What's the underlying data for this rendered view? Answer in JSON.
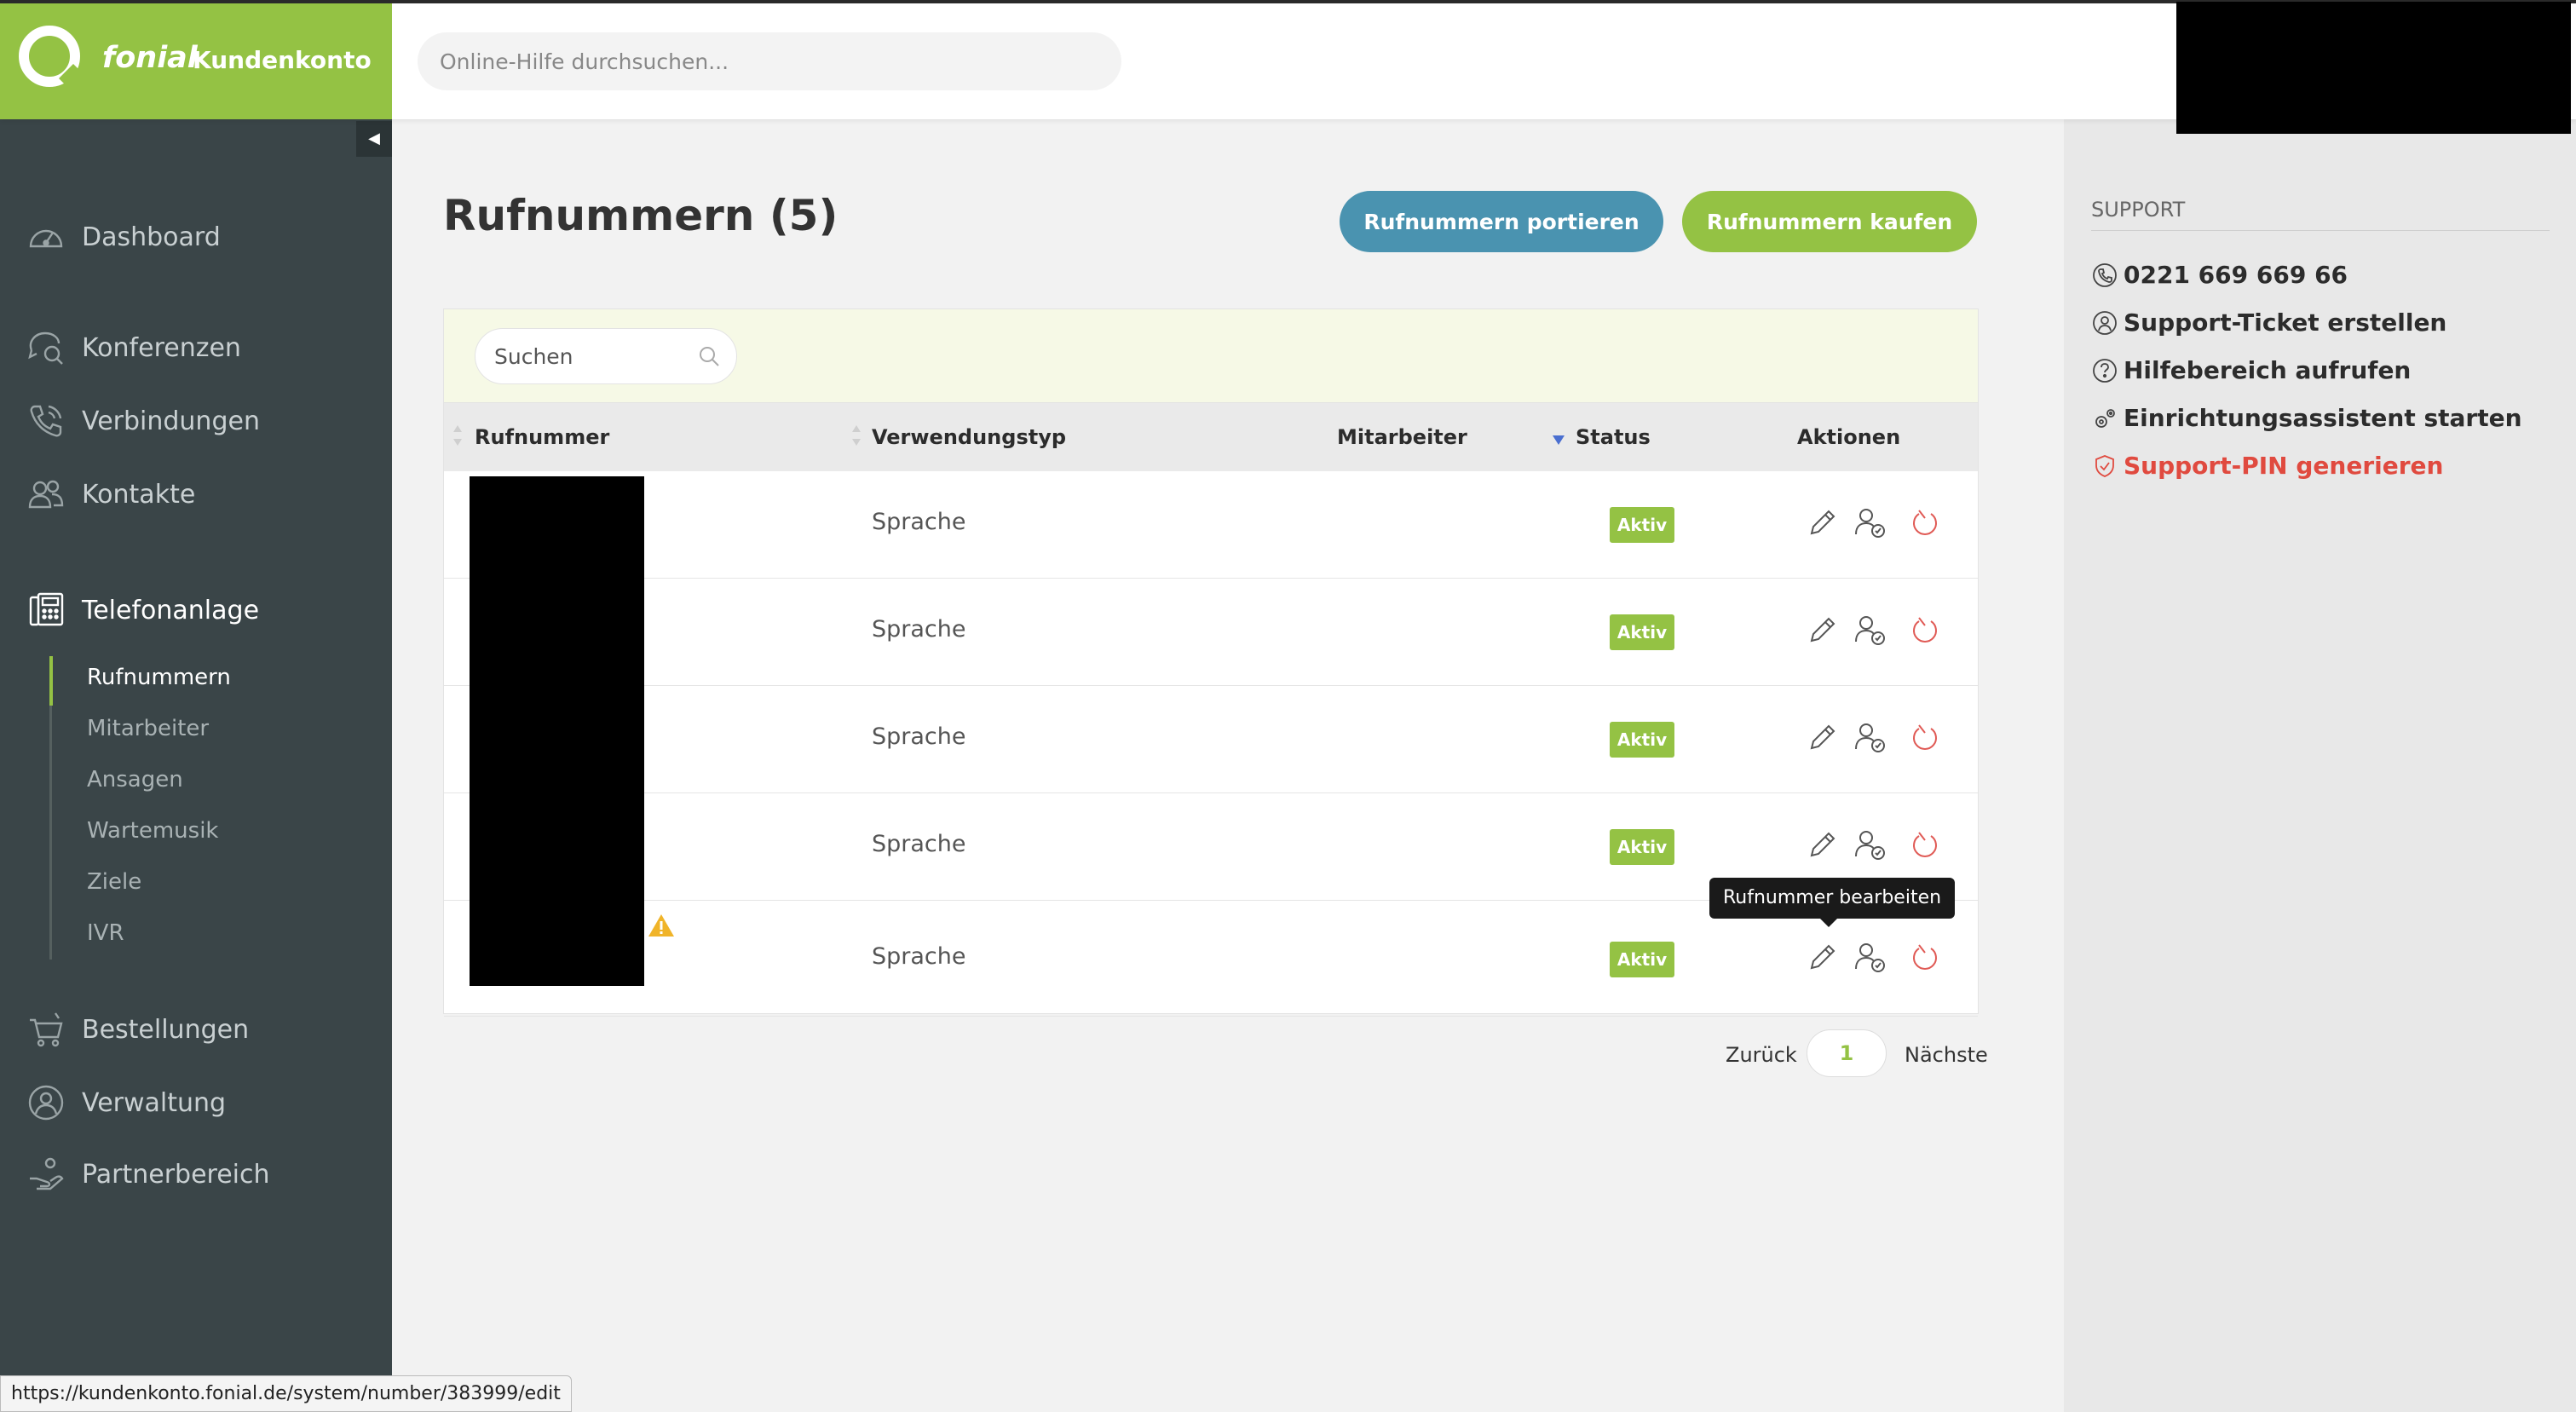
{
  "brand": {
    "name": "fonial",
    "subtitle": "Kundenkonto",
    "color": "#94c244"
  },
  "header": {
    "search_placeholder": "Online-Hilfe durchsuchen..."
  },
  "sidebar": {
    "items": [
      {
        "label": "Dashboard",
        "icon": "speedometer-icon"
      },
      {
        "label": "Konferenzen",
        "icon": "chat-search-icon"
      },
      {
        "label": "Verbindungen",
        "icon": "phone-waves-icon"
      },
      {
        "label": "Kontakte",
        "icon": "contacts-icon"
      },
      {
        "label": "Telefonanlage",
        "icon": "desk-phone-icon",
        "active": true
      },
      {
        "label": "Bestellungen",
        "icon": "cart-icon"
      },
      {
        "label": "Verwaltung",
        "icon": "user-circle-icon"
      },
      {
        "label": "Partnerbereich",
        "icon": "hand-coin-icon"
      }
    ],
    "subitems": [
      {
        "label": "Rufnummern",
        "active": true
      },
      {
        "label": "Mitarbeiter"
      },
      {
        "label": "Ansagen"
      },
      {
        "label": "Wartemusik"
      },
      {
        "label": "Ziele"
      },
      {
        "label": "IVR"
      }
    ]
  },
  "main": {
    "title": "Rufnummern (5)",
    "buttons": {
      "port": "Rufnummern portieren",
      "buy": "Rufnummern kaufen"
    },
    "table": {
      "search_placeholder": "Suchen",
      "columns": [
        "Rufnummer",
        "Verwendungstyp",
        "Mitarbeiter",
        "Status",
        "Aktionen"
      ],
      "rows": [
        {
          "type": "Sprache",
          "status": "Aktiv"
        },
        {
          "type": "Sprache",
          "status": "Aktiv"
        },
        {
          "type": "Sprache",
          "status": "Aktiv"
        },
        {
          "type": "Sprache",
          "status": "Aktiv"
        },
        {
          "type": "Sprache",
          "status": "Aktiv",
          "warning": true
        }
      ],
      "tooltip": "Rufnummer bearbeiten"
    },
    "pager": {
      "prev": "Zurück",
      "page": "1",
      "next": "Nächste"
    }
  },
  "support": {
    "title": "SUPPORT",
    "items": [
      {
        "label": "0221 669 669 66",
        "icon": "phone-icon"
      },
      {
        "label": "Support-Ticket erstellen",
        "icon": "headset-icon"
      },
      {
        "label": "Hilfebereich aufrufen",
        "icon": "help-circle-icon"
      },
      {
        "label": "Einrichtungsassistent starten",
        "icon": "gears-icon"
      },
      {
        "label": "Support-PIN generieren",
        "icon": "shield-icon",
        "danger": true
      }
    ]
  },
  "status_url": "https://kundenkonto.fonial.de/system/number/383999/edit"
}
